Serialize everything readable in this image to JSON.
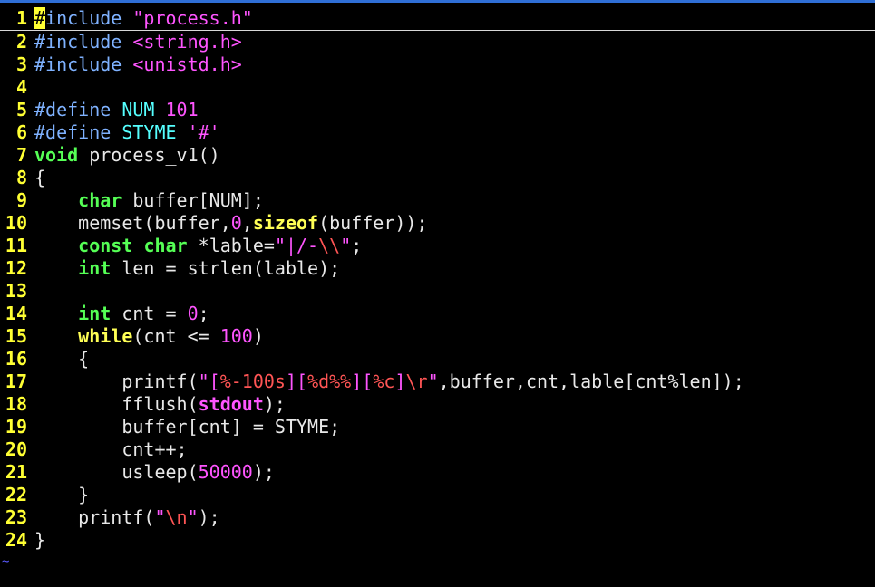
{
  "editor": {
    "colors": {
      "line_number": "#ffff33",
      "preproc": "#7fb2ff",
      "string": "#ff55ff",
      "type": "#55ff55",
      "keyword": "#ffff55",
      "constant": "#55ffff",
      "escape": "#ff5555"
    },
    "lines": [
      {
        "n": "1",
        "segs": [
          {
            "t": "#",
            "c": "cursor"
          },
          {
            "t": "include ",
            "c": "c-pre"
          },
          {
            "t": "\"process.h\"",
            "c": "c-str"
          }
        ]
      },
      {
        "n": "2",
        "segs": [
          {
            "t": "#include ",
            "c": "c-pre"
          },
          {
            "t": "<string.h>",
            "c": "c-str"
          }
        ]
      },
      {
        "n": "3",
        "segs": [
          {
            "t": "#include ",
            "c": "c-pre"
          },
          {
            "t": "<unistd.h>",
            "c": "c-str"
          }
        ]
      },
      {
        "n": "4",
        "segs": []
      },
      {
        "n": "5",
        "segs": [
          {
            "t": "#define ",
            "c": "c-pre"
          },
          {
            "t": "NUM ",
            "c": "c-const"
          },
          {
            "t": "101",
            "c": "c-num"
          }
        ]
      },
      {
        "n": "6",
        "segs": [
          {
            "t": "#define ",
            "c": "c-pre"
          },
          {
            "t": "STYME ",
            "c": "c-const"
          },
          {
            "t": "'#'",
            "c": "c-str"
          }
        ]
      },
      {
        "n": "7",
        "segs": [
          {
            "t": "void",
            "c": "c-type"
          },
          {
            "t": " process_v1()",
            "c": ""
          }
        ]
      },
      {
        "n": "8",
        "segs": [
          {
            "t": "{",
            "c": ""
          }
        ]
      },
      {
        "n": "9",
        "segs": [
          {
            "t": "    ",
            "c": ""
          },
          {
            "t": "char",
            "c": "c-type"
          },
          {
            "t": " buffer[NUM];",
            "c": ""
          }
        ]
      },
      {
        "n": "10",
        "segs": [
          {
            "t": "    memset(buffer,",
            "c": ""
          },
          {
            "t": "0",
            "c": "c-num"
          },
          {
            "t": ",",
            "c": ""
          },
          {
            "t": "sizeof",
            "c": "c-sz"
          },
          {
            "t": "(buffer));",
            "c": ""
          }
        ]
      },
      {
        "n": "11",
        "segs": [
          {
            "t": "    ",
            "c": ""
          },
          {
            "t": "const",
            "c": "c-type"
          },
          {
            "t": " ",
            "c": ""
          },
          {
            "t": "char",
            "c": "c-type"
          },
          {
            "t": " *lable=",
            "c": ""
          },
          {
            "t": "\"|/-",
            "c": "c-str"
          },
          {
            "t": "\\\\",
            "c": "c-esc"
          },
          {
            "t": "\"",
            "c": "c-str"
          },
          {
            "t": ";",
            "c": ""
          }
        ]
      },
      {
        "n": "12",
        "segs": [
          {
            "t": "    ",
            "c": ""
          },
          {
            "t": "int",
            "c": "c-type"
          },
          {
            "t": " len = strlen(lable);",
            "c": ""
          }
        ]
      },
      {
        "n": "13",
        "segs": []
      },
      {
        "n": "14",
        "segs": [
          {
            "t": "    ",
            "c": ""
          },
          {
            "t": "int",
            "c": "c-type"
          },
          {
            "t": " cnt = ",
            "c": ""
          },
          {
            "t": "0",
            "c": "c-num"
          },
          {
            "t": ";",
            "c": ""
          }
        ]
      },
      {
        "n": "15",
        "segs": [
          {
            "t": "    ",
            "c": ""
          },
          {
            "t": "while",
            "c": "c-kw"
          },
          {
            "t": "(cnt <= ",
            "c": ""
          },
          {
            "t": "100",
            "c": "c-num"
          },
          {
            "t": ")",
            "c": ""
          }
        ]
      },
      {
        "n": "16",
        "segs": [
          {
            "t": "    {",
            "c": ""
          }
        ]
      },
      {
        "n": "17",
        "segs": [
          {
            "t": "        printf(",
            "c": ""
          },
          {
            "t": "\"[",
            "c": "c-str"
          },
          {
            "t": "%-100s",
            "c": "c-esc"
          },
          {
            "t": "][",
            "c": "c-str"
          },
          {
            "t": "%d%%",
            "c": "c-esc"
          },
          {
            "t": "][",
            "c": "c-str"
          },
          {
            "t": "%c",
            "c": "c-esc"
          },
          {
            "t": "]",
            "c": "c-str"
          },
          {
            "t": "\\r",
            "c": "c-esc"
          },
          {
            "t": "\"",
            "c": "c-str"
          },
          {
            "t": ",buffer,cnt,lable[cnt%len]);",
            "c": ""
          }
        ]
      },
      {
        "n": "18",
        "segs": [
          {
            "t": "        fflush(",
            "c": ""
          },
          {
            "t": "stdout",
            "c": "c-std"
          },
          {
            "t": ");",
            "c": ""
          }
        ]
      },
      {
        "n": "19",
        "segs": [
          {
            "t": "        buffer[cnt] = STYME;",
            "c": ""
          }
        ]
      },
      {
        "n": "20",
        "segs": [
          {
            "t": "        cnt++;",
            "c": ""
          }
        ]
      },
      {
        "n": "21",
        "segs": [
          {
            "t": "        usleep(",
            "c": ""
          },
          {
            "t": "50000",
            "c": "c-num"
          },
          {
            "t": ");",
            "c": ""
          }
        ]
      },
      {
        "n": "22",
        "segs": [
          {
            "t": "    }",
            "c": ""
          }
        ]
      },
      {
        "n": "23",
        "segs": [
          {
            "t": "    printf(",
            "c": ""
          },
          {
            "t": "\"",
            "c": "c-str"
          },
          {
            "t": "\\n",
            "c": "c-esc"
          },
          {
            "t": "\"",
            "c": "c-str"
          },
          {
            "t": ");",
            "c": ""
          }
        ]
      },
      {
        "n": "24",
        "segs": [
          {
            "t": "}",
            "c": ""
          }
        ]
      }
    ],
    "empty_line_marker": "~"
  }
}
